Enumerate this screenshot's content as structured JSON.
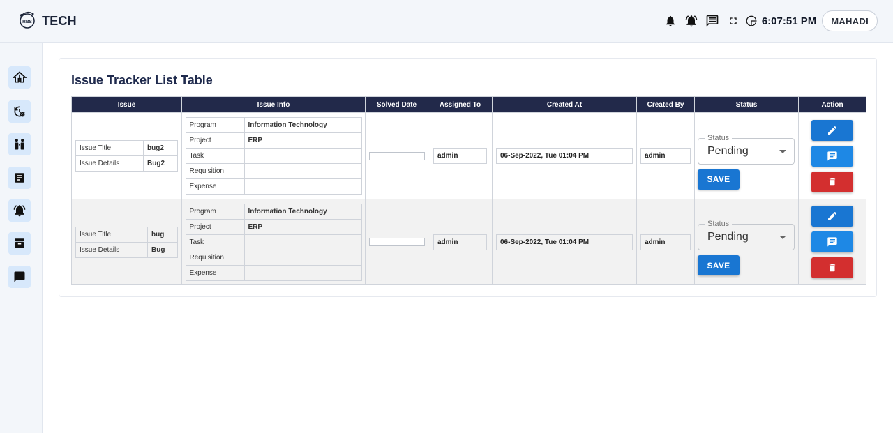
{
  "app": {
    "logo_text": "TECH",
    "logo_mark_text": "RBS",
    "clock": "6:07:51 PM",
    "user": "MAHADI"
  },
  "icons": {
    "header": [
      "bell-icon",
      "alarm-icon",
      "message-icon",
      "fullscreen-icon",
      "clock-icon"
    ],
    "sidebar": [
      "home-icon",
      "settings-history-icon",
      "people-icon",
      "document-icon",
      "alarm-icon",
      "archive-icon",
      "chat-icon"
    ]
  },
  "page": {
    "title": "Issue Tracker List Table"
  },
  "table": {
    "headers": [
      "Issue",
      "Issue Info",
      "Solved Date",
      "Assigned To",
      "Created At",
      "Created By",
      "Status",
      "Action"
    ],
    "rows": [
      {
        "issue_title_label": "Issue Title",
        "issue_title": "bug2",
        "issue_details_label": "Issue Details",
        "issue_details": "Bug2",
        "info": [
          {
            "label": "Program",
            "value": "Information Technology"
          },
          {
            "label": "Project",
            "value": "ERP"
          },
          {
            "label": "Task",
            "value": ""
          },
          {
            "label": "Requisition",
            "value": ""
          },
          {
            "label": "Expense",
            "value": ""
          }
        ],
        "solved_date": "",
        "assigned_to": "admin",
        "created_at": "06-Sep-2022, Tue 01:04 PM",
        "created_by": "admin",
        "status_label": "Status",
        "status": "Pending",
        "save_label": "SAVE"
      },
      {
        "issue_title_label": "Issue Title",
        "issue_title": "bug",
        "issue_details_label": "Issue Details",
        "issue_details": "Bug",
        "info": [
          {
            "label": "Program",
            "value": "Information Technology"
          },
          {
            "label": "Project",
            "value": "ERP"
          },
          {
            "label": "Task",
            "value": ""
          },
          {
            "label": "Requisition",
            "value": ""
          },
          {
            "label": "Expense",
            "value": ""
          }
        ],
        "solved_date": "",
        "assigned_to": "admin",
        "created_at": "06-Sep-2022, Tue 01:04 PM",
        "created_by": "admin",
        "status_label": "Status",
        "status": "Pending",
        "save_label": "SAVE"
      }
    ]
  },
  "colors": {
    "header_bg": "#22294a",
    "primary": "#1976d2",
    "danger": "#d32f2f",
    "title": "#1f2a4d"
  }
}
